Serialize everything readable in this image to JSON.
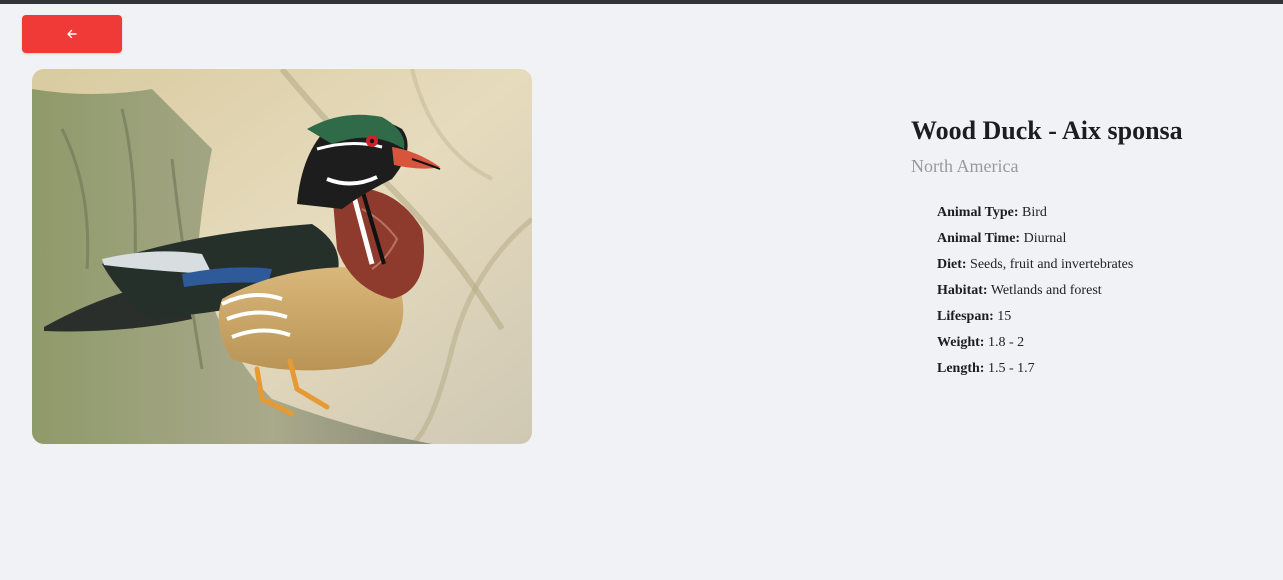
{
  "nav": {
    "back_icon": "arrow-left-icon",
    "accent_color": "#f03a37"
  },
  "animal": {
    "name": "Wood Duck - Aix sponsa",
    "region": "North America",
    "facts": [
      {
        "label": "Animal Type:",
        "value": "Bird"
      },
      {
        "label": "Animal Time:",
        "value": "Diurnal"
      },
      {
        "label": "Diet:",
        "value": "Seeds, fruit and invertebrates"
      },
      {
        "label": "Habitat:",
        "value": "Wetlands and forest"
      },
      {
        "label": "Lifespan:",
        "value": "15"
      },
      {
        "label": "Weight:",
        "value": "1.8 - 2"
      },
      {
        "label": "Length:",
        "value": "1.5 - 1.7"
      }
    ]
  }
}
